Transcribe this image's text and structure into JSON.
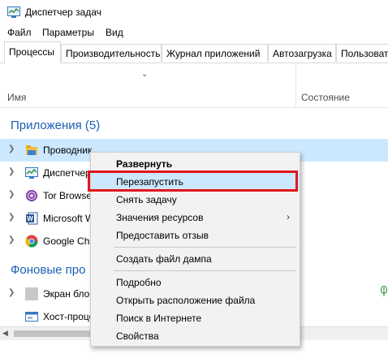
{
  "window": {
    "title": "Диспетчер задач",
    "icon": "task-manager-icon"
  },
  "menu": [
    "Файл",
    "Параметры",
    "Вид"
  ],
  "tabs": [
    {
      "label": "Процессы",
      "active": true
    },
    {
      "label": "Производительность"
    },
    {
      "label": "Журнал приложений"
    },
    {
      "label": "Автозагрузка"
    },
    {
      "label": "Пользовате"
    }
  ],
  "columns": {
    "name": "Имя",
    "state": "Состояние"
  },
  "groups": {
    "apps": {
      "title": "Приложения (5)",
      "rows": [
        {
          "label": "Проводник",
          "icon": "folder-icon",
          "selected": true
        },
        {
          "label": "Диспетчер",
          "icon": "task-manager-icon"
        },
        {
          "label": "Tor Browse",
          "icon": "tor-icon"
        },
        {
          "label": "Microsoft W",
          "icon": "word-icon"
        },
        {
          "label": "Google Ch",
          "icon": "chrome-icon"
        }
      ]
    },
    "background": {
      "title": "Фоновые про",
      "rows": [
        {
          "label": "Экран блоки",
          "icon": "lockscreen-icon"
        },
        {
          "label": "Хост-проце",
          "icon": "host-process-icon"
        }
      ]
    }
  },
  "context_menu": {
    "items": [
      {
        "label": "Развернуть",
        "bold": true
      },
      {
        "label": "Перезапустить",
        "highlighted": true
      },
      {
        "label": "Снять задачу"
      },
      {
        "label": "Значения ресурсов",
        "submenu": true
      },
      {
        "label": "Предоставить отзыв"
      },
      {
        "label": "Создать файл дампа"
      },
      {
        "label": "Подробно"
      },
      {
        "label": "Открыть расположение файла"
      },
      {
        "label": "Поиск в Интернете"
      },
      {
        "label": "Свойства"
      }
    ]
  },
  "colors": {
    "accent": "#1a5fb4",
    "selection": "#cce8ff",
    "highlight_outline": "#e0161d"
  }
}
